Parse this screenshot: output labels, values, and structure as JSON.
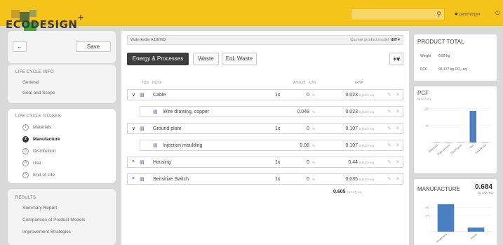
{
  "app": {
    "logo_text": "ECODESIGN",
    "logo_plus": "+"
  },
  "topbar": {
    "search_placeholder": "",
    "user_name": "pamminger",
    "icons": [
      "search-icon",
      "user-icon",
      "power-icon"
    ]
  },
  "sidebar": {
    "back_arrow": "←",
    "save_label": "Save",
    "life_cycle_info": {
      "title": "LIFE CYCLE INFO",
      "items": [
        "General",
        "Goal and Scope"
      ]
    },
    "life_cycle_stages": {
      "title": "LIFE CYCLE STAGES",
      "items": [
        {
          "num": "1",
          "label": "Materials",
          "active": false
        },
        {
          "num": "2",
          "label": "Manufacture",
          "active": true
        },
        {
          "num": "3",
          "label": "Distribution",
          "active": false
        },
        {
          "num": "4",
          "label": "Use",
          "active": false
        },
        {
          "num": "5",
          "label": "End of Life",
          "active": false
        }
      ]
    },
    "results": {
      "title": "RESULTS",
      "items": [
        "Summary Report",
        "Comparison of Product Models",
        "Improvement Strategies"
      ]
    }
  },
  "main": {
    "product_name": "Waterkettle A DEMO",
    "current_model_label": "Current product model:",
    "current_model_value": "diff ▾",
    "tabs": [
      {
        "label": "Energy & Processes",
        "active": true
      },
      {
        "label": "Waste",
        "active": false
      },
      {
        "label": "EoL Waste",
        "active": false
      }
    ],
    "add_button": "+▾",
    "columns": {
      "type": "Type",
      "name": "Name",
      "amount": "Amount",
      "unit": "Unit",
      "gwp": "GWP"
    },
    "rows": [
      {
        "level": 0,
        "toggle": "∨",
        "name": "Cable",
        "qty": "1x",
        "amount": "0",
        "unit": "%",
        "gwp": "0.023",
        "gwp_unit": "kg CO₂-eq"
      },
      {
        "level": 1,
        "toggle": "",
        "name": "Wire drawing, copper",
        "qty": "",
        "amount": "0.048",
        "unit": "%",
        "gwp": "0.023",
        "gwp_unit": "kg CO₂-eq"
      },
      {
        "level": 0,
        "toggle": "∨",
        "name": "Ground plate",
        "qty": "1x",
        "amount": "0",
        "unit": "%",
        "gwp": "0.107",
        "gwp_unit": "kg CO₂-eq"
      },
      {
        "level": 1,
        "toggle": "",
        "name": "Injection moulding",
        "qty": "",
        "amount": "0.08",
        "unit": "%",
        "gwp": "0.107",
        "gwp_unit": "kg CO₂-eq"
      },
      {
        "level": 0,
        "toggle": ">",
        "name": "Housing",
        "qty": "1x",
        "amount": "0",
        "unit": "%",
        "gwp": "0.44",
        "gwp_unit": "kg CO₂-eq"
      },
      {
        "level": 0,
        "toggle": ">",
        "name": "Sensitive Switch",
        "qty": "1x",
        "amount": "0",
        "unit": "%",
        "gwp": "0.035",
        "gwp_unit": "kg CO₂-eq"
      }
    ],
    "total": "0.605",
    "total_unit": "kg CO₂-eq"
  },
  "right": {
    "product_total": {
      "title": "PRODUCT TOTAL",
      "weight_label": "Weight",
      "weight_value": "0.89 kg",
      "pcf_label": "PCF",
      "pcf_value": "93.177 kg CO₂-eq"
    },
    "pcf_chart_title": "PCF",
    "pcf_chart_unit": "kg CO₂-eq",
    "manufacture": {
      "title": "MANUFACTURE",
      "value": "0.684",
      "unit": "kg CO₂-eq"
    }
  },
  "chart_data": [
    {
      "type": "bar",
      "title": "PCF",
      "ylabel": "kg CO₂-eq",
      "categories": [
        "Materials",
        "Manufacture",
        "Distribution",
        "Use",
        "End of Life"
      ],
      "values": [
        0.5,
        0.7,
        0.3,
        93,
        0.2
      ],
      "ytick_labels": [
        "100",
        "50"
      ],
      "yticks": [
        100,
        50
      ],
      "ylim": [
        0,
        120
      ],
      "color": "#4a7fc1"
    },
    {
      "type": "bar",
      "title": "MANUFACTURE",
      "categories": [
        "Processes",
        "Waste"
      ],
      "values": [
        0.68,
        0.1
      ],
      "ytick_labels": [
        "0.6",
        "0.4"
      ],
      "yticks": [
        0.6,
        0.4
      ],
      "ylim": [
        0,
        0.8
      ],
      "color": "#4a7fc1"
    }
  ]
}
